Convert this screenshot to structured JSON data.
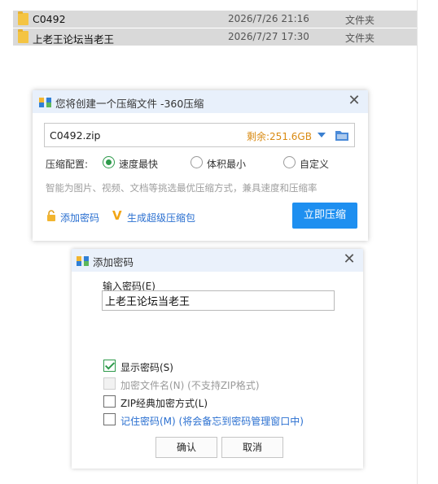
{
  "explorer": {
    "rows": [
      {
        "name": "C0492",
        "date": "2026/7/26 21:16",
        "type": "文件夹"
      },
      {
        "name": "上老王论坛当老王",
        "date": "2026/7/27 17:30",
        "type": "文件夹"
      }
    ]
  },
  "compress_dialog": {
    "title": "您将创建一个压缩文件 -360压缩",
    "filename": "C0492.zip",
    "free_space": "剩余:251.6GB",
    "config_label": "压缩配置:",
    "options": [
      "速度最快",
      "体积最小",
      "自定义"
    ],
    "selected_option": "速度最快",
    "hint": "智能为图片、视频、文档等挑选最优压缩方式，兼具速度和压缩率",
    "add_password_link": "添加密码",
    "super_package_link": "生成超级压缩包",
    "compress_button": "立即压缩",
    "accent_color": "#1e8ff0"
  },
  "password_dialog": {
    "title": "添加密码",
    "input_label": "输入密码(E)",
    "password_value": "上老王论坛当老王",
    "checkboxes": [
      {
        "label": "显示密码(S)",
        "checked": true,
        "disabled": false
      },
      {
        "label": "加密文件名(N) (不支持ZIP格式)",
        "checked": false,
        "disabled": true
      },
      {
        "label": "ZIP经典加密方式(L)",
        "checked": false,
        "disabled": false
      },
      {
        "label": "记住密码(M) (将会备忘到密码管理窗口中)",
        "checked": false,
        "disabled": false
      }
    ],
    "ok_button": "确认",
    "cancel_button": "取消"
  }
}
